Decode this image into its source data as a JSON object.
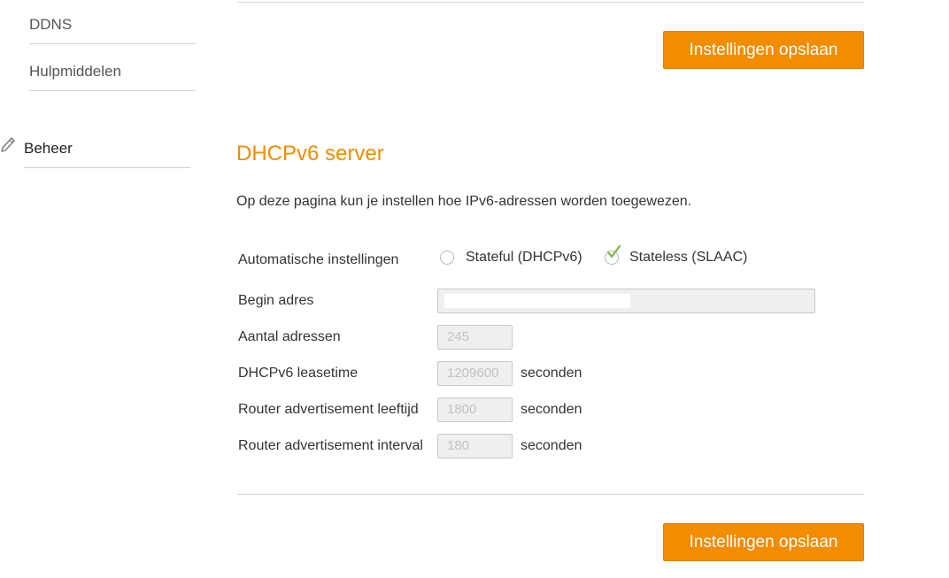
{
  "sidebar": {
    "items": [
      {
        "label": "DDNS"
      },
      {
        "label": "Hulpmiddelen"
      }
    ],
    "section": {
      "label": "Beheer",
      "icon": "pencil-icon"
    }
  },
  "save_button_label": "Instellingen opslaan",
  "section": {
    "title": "DHCPv6 server",
    "description": "Op deze pagina kun je instellen hoe IPv6-adressen worden toegewezen."
  },
  "form": {
    "auto_settings": {
      "label": "Automatische instellingen",
      "options": [
        {
          "label": "Stateful (DHCPv6)",
          "selected": false
        },
        {
          "label": "Stateless (SLAAC)",
          "selected": true
        }
      ]
    },
    "begin_address": {
      "label": "Begin adres",
      "value": ""
    },
    "address_count": {
      "label": "Aantal adressen",
      "value": "245"
    },
    "leasetime": {
      "label": "DHCPv6 leasetime",
      "value": "1209600",
      "unit": "seconden"
    },
    "ra_lifetime": {
      "label": "Router advertisement leeftijd",
      "value": "1800",
      "unit": "seconden"
    },
    "ra_interval": {
      "label": "Router advertisement interval",
      "value": "180",
      "unit": "seconden"
    }
  },
  "colors": {
    "accent": "#f28c00",
    "check": "#7ab648"
  }
}
